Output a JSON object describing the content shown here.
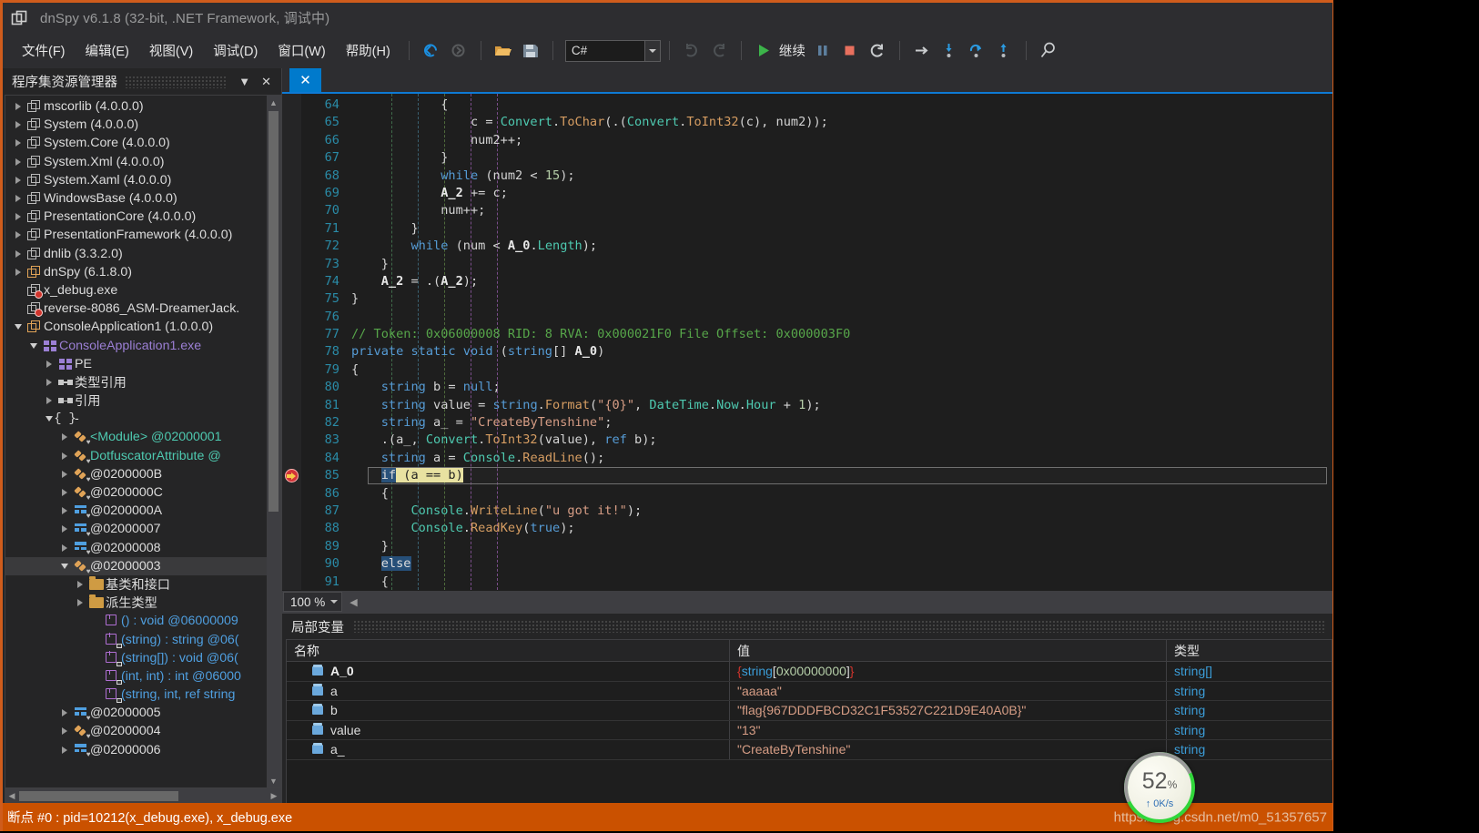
{
  "window": {
    "title": "dnSpy v6.1.8 (32-bit, .NET Framework, 调试中)",
    "icon": "assembly-icon"
  },
  "menu": {
    "items": [
      {
        "label": "文件(F)",
        "name": "menu-file"
      },
      {
        "label": "编辑(E)",
        "name": "menu-edit"
      },
      {
        "label": "视图(V)",
        "name": "menu-view"
      },
      {
        "label": "调试(D)",
        "name": "menu-debug"
      },
      {
        "label": "窗口(W)",
        "name": "menu-window"
      },
      {
        "label": "帮助(H)",
        "name": "menu-help"
      }
    ]
  },
  "toolbar": {
    "language_combo_value": "C#",
    "continue_label": "继续",
    "icons": [
      "back-icon",
      "forward-icon",
      "open-file-icon",
      "save-icon",
      "undo-icon",
      "redo-icon",
      "continue-play-icon",
      "pause-icon",
      "stop-icon",
      "restart-icon",
      "step-over-icon",
      "step-into-icon",
      "step-out-of-icon",
      "step-out-icon",
      "search-icon"
    ]
  },
  "sidebar": {
    "title": "程序集资源管理器",
    "dropdown_label": "▼",
    "close_label": "✕",
    "nodes": [
      {
        "label": "mscorlib (4.0.0.0)",
        "indent": 0,
        "twist": "closed",
        "icon": "assembly-icon",
        "name": "tree-node-mscorlib"
      },
      {
        "label": "System (4.0.0.0)",
        "indent": 0,
        "twist": "closed",
        "icon": "assembly-icon",
        "name": "tree-node-system"
      },
      {
        "label": "System.Core (4.0.0.0)",
        "indent": 0,
        "twist": "closed",
        "icon": "assembly-icon",
        "name": "tree-node-system-core"
      },
      {
        "label": "System.Xml (4.0.0.0)",
        "indent": 0,
        "twist": "closed",
        "icon": "assembly-icon",
        "name": "tree-node-system-xml"
      },
      {
        "label": "System.Xaml (4.0.0.0)",
        "indent": 0,
        "twist": "closed",
        "icon": "assembly-icon",
        "name": "tree-node-system-xaml"
      },
      {
        "label": "WindowsBase (4.0.0.0)",
        "indent": 0,
        "twist": "closed",
        "icon": "assembly-icon",
        "name": "tree-node-windowsbase"
      },
      {
        "label": "PresentationCore (4.0.0.0)",
        "indent": 0,
        "twist": "closed",
        "icon": "assembly-icon",
        "name": "tree-node-presentationcore"
      },
      {
        "label": "PresentationFramework (4.0.0.0)",
        "indent": 0,
        "twist": "closed",
        "icon": "assembly-icon",
        "name": "tree-node-presentationframework"
      },
      {
        "label": "dnlib (3.3.2.0)",
        "indent": 0,
        "twist": "closed",
        "icon": "assembly-icon",
        "name": "tree-node-dnlib"
      },
      {
        "label": "dnSpy (6.1.8.0)",
        "indent": 0,
        "twist": "closed",
        "icon": "assembly-icon-orange",
        "name": "tree-node-dnspy"
      },
      {
        "label": "x_debug.exe",
        "indent": 0,
        "twist": "none",
        "icon": "assembly-error-icon",
        "name": "tree-node-x-debug"
      },
      {
        "label": "reverse-8086_ASM-DreamerJack.",
        "indent": 0,
        "twist": "none",
        "icon": "assembly-error-icon",
        "name": "tree-node-reverse-8086"
      },
      {
        "label": "ConsoleApplication1 (1.0.0.0)",
        "indent": 0,
        "twist": "open",
        "icon": "assembly-icon-orange",
        "name": "tree-node-consoleapplication1"
      },
      {
        "label": "ConsoleApplication1.exe",
        "indent": 1,
        "twist": "open",
        "icon": "module-icon",
        "name": "tree-node-consoleapplication1-exe",
        "color": "#9b7fd4"
      },
      {
        "label": "PE",
        "indent": 2,
        "twist": "closed",
        "icon": "module-icon",
        "name": "tree-node-pe"
      },
      {
        "label": "类型引用",
        "indent": 2,
        "twist": "closed",
        "icon": "reference-icon",
        "name": "tree-node-type-references"
      },
      {
        "label": "引用",
        "indent": 2,
        "twist": "closed",
        "icon": "reference-icon",
        "name": "tree-node-references"
      },
      {
        "label": "-",
        "indent": 2,
        "twist": "open",
        "icon": "namespace-icon",
        "name": "tree-node-namespace"
      },
      {
        "label": "<Module> @02000001",
        "indent": 3,
        "twist": "closed",
        "icon": "class-icon",
        "name": "tree-node-module-class",
        "color": "#4ec9b0"
      },
      {
        "label": "DotfuscatorAttribute @",
        "indent": 3,
        "twist": "closed",
        "icon": "class-icon",
        "name": "tree-node-dotfuscatorattribute",
        "color": "#4ec9b0"
      },
      {
        "label": "@0200000B",
        "indent": 3,
        "twist": "closed",
        "icon": "class-icon",
        "name": "tree-node-0200000b"
      },
      {
        "label": "@0200000C",
        "indent": 3,
        "twist": "closed",
        "icon": "class-icon",
        "name": "tree-node-0200000c"
      },
      {
        "label": "@0200000A",
        "indent": 3,
        "twist": "closed",
        "icon": "interface-icon",
        "name": "tree-node-0200000a"
      },
      {
        "label": "@02000007",
        "indent": 3,
        "twist": "closed",
        "icon": "interface-icon",
        "name": "tree-node-02000007"
      },
      {
        "label": "@02000008",
        "indent": 3,
        "twist": "closed",
        "icon": "interface-icon",
        "name": "tree-node-02000008"
      },
      {
        "label": "@02000003",
        "indent": 3,
        "twist": "open",
        "icon": "class-icon",
        "name": "tree-node-02000003",
        "selected": true
      },
      {
        "label": "基类和接口",
        "indent": 4,
        "twist": "closed",
        "icon": "folder-icon",
        "name": "tree-node-base-types"
      },
      {
        "label": "派生类型",
        "indent": 4,
        "twist": "closed",
        "icon": "folder-icon",
        "name": "tree-node-derived-types"
      },
      {
        "label": "() : void @06000009",
        "indent": 5,
        "twist": "none",
        "icon": "method-icon",
        "name": "tree-node-method-ctor",
        "color": "#4f9fe0"
      },
      {
        "label": "(string) : string @06(",
        "indent": 5,
        "twist": "none",
        "icon": "method-lock-icon",
        "name": "tree-node-method-string",
        "color": "#4f9fe0"
      },
      {
        "label": "(string[]) : void @06(",
        "indent": 5,
        "twist": "none",
        "icon": "method-lock-icon",
        "name": "tree-node-method-stringarr",
        "color": "#4f9fe0"
      },
      {
        "label": "(int, int) : int @06000",
        "indent": 5,
        "twist": "none",
        "icon": "method-lock-icon",
        "name": "tree-node-method-intint",
        "color": "#4f9fe0"
      },
      {
        "label": "(string, int, ref string",
        "indent": 5,
        "twist": "none",
        "icon": "method-lock-icon",
        "name": "tree-node-method-stringintref",
        "color": "#4f9fe0"
      },
      {
        "label": "@02000005",
        "indent": 3,
        "twist": "closed",
        "icon": "interface-icon",
        "name": "tree-node-02000005"
      },
      {
        "label": "@02000004",
        "indent": 3,
        "twist": "closed",
        "icon": "class-icon",
        "name": "tree-node-02000004"
      },
      {
        "label": "@02000006",
        "indent": 3,
        "twist": "closed",
        "icon": "interface-icon",
        "name": "tree-node-02000006"
      }
    ]
  },
  "editor": {
    "tab_close_label": "✕",
    "zoom_level": "100 %",
    "breakpoint_line": 85,
    "lines": [
      {
        "n": 64,
        "tokens": [
          {
            "t": "            {",
            "c": "pl"
          }
        ]
      },
      {
        "n": 65,
        "tokens": [
          {
            "t": "                c = ",
            "c": "pl"
          },
          {
            "t": "Convert",
            "c": "ty"
          },
          {
            "t": ".",
            "c": "pl"
          },
          {
            "t": "ToChar",
            "c": "mth"
          },
          {
            "t": "(.(",
            "c": "pl"
          },
          {
            "t": "Convert",
            "c": "ty"
          },
          {
            "t": ".",
            "c": "pl"
          },
          {
            "t": "ToInt32",
            "c": "mth"
          },
          {
            "t": "(c), num2));",
            "c": "pl"
          }
        ]
      },
      {
        "n": 66,
        "tokens": [
          {
            "t": "                num2++;",
            "c": "pl"
          }
        ]
      },
      {
        "n": 67,
        "tokens": [
          {
            "t": "            }",
            "c": "pl"
          }
        ]
      },
      {
        "n": 68,
        "tokens": [
          {
            "t": "            ",
            "c": "pl"
          },
          {
            "t": "while",
            "c": "k"
          },
          {
            "t": " (num2 < ",
            "c": "pl"
          },
          {
            "t": "15",
            "c": "num"
          },
          {
            "t": ");",
            "c": "pl"
          }
        ]
      },
      {
        "n": 69,
        "tokens": [
          {
            "t": "            ",
            "c": "pl"
          },
          {
            "t": "A_2",
            "c": "bold"
          },
          {
            "t": " += c;",
            "c": "pl"
          }
        ]
      },
      {
        "n": 70,
        "tokens": [
          {
            "t": "            num++;",
            "c": "pl"
          }
        ]
      },
      {
        "n": 71,
        "tokens": [
          {
            "t": "        }",
            "c": "pl"
          }
        ]
      },
      {
        "n": 72,
        "tokens": [
          {
            "t": "        ",
            "c": "pl"
          },
          {
            "t": "while",
            "c": "k"
          },
          {
            "t": " (num < ",
            "c": "pl"
          },
          {
            "t": "A_0",
            "c": "bold"
          },
          {
            "t": ".",
            "c": "pl"
          },
          {
            "t": "Length",
            "c": "ty"
          },
          {
            "t": ");",
            "c": "pl"
          }
        ]
      },
      {
        "n": 73,
        "tokens": [
          {
            "t": "    }",
            "c": "pl"
          }
        ]
      },
      {
        "n": 74,
        "tokens": [
          {
            "t": "    ",
            "c": "pl"
          },
          {
            "t": "A_2",
            "c": "bold"
          },
          {
            "t": " = .(",
            "c": "pl"
          },
          {
            "t": "A_2",
            "c": "bold"
          },
          {
            "t": ");",
            "c": "pl"
          }
        ]
      },
      {
        "n": 75,
        "tokens": [
          {
            "t": "}",
            "c": "pl"
          }
        ]
      },
      {
        "n": 76,
        "tokens": [
          {
            "t": "",
            "c": "pl"
          }
        ]
      },
      {
        "n": 77,
        "tokens": [
          {
            "t": "// Token: 0x06000008 RID: 8 RVA: 0x000021F0 File Offset: 0x000003F0",
            "c": "cm"
          }
        ]
      },
      {
        "n": 78,
        "tokens": [
          {
            "t": "private static void",
            "c": "k"
          },
          {
            "t": " (",
            "c": "pl"
          },
          {
            "t": "string",
            "c": "k"
          },
          {
            "t": "[] ",
            "c": "pl"
          },
          {
            "t": "A_0",
            "c": "bold"
          },
          {
            "t": ")",
            "c": "pl"
          }
        ]
      },
      {
        "n": 79,
        "tokens": [
          {
            "t": "{",
            "c": "pl"
          }
        ]
      },
      {
        "n": 80,
        "tokens": [
          {
            "t": "    ",
            "c": "pl"
          },
          {
            "t": "string",
            "c": "k"
          },
          {
            "t": " b = ",
            "c": "pl"
          },
          {
            "t": "null",
            "c": "k"
          },
          {
            "t": ";",
            "c": "pl"
          }
        ]
      },
      {
        "n": 81,
        "tokens": [
          {
            "t": "    ",
            "c": "pl"
          },
          {
            "t": "string",
            "c": "k"
          },
          {
            "t": " value = ",
            "c": "pl"
          },
          {
            "t": "string",
            "c": "k"
          },
          {
            "t": ".",
            "c": "pl"
          },
          {
            "t": "Format",
            "c": "mth"
          },
          {
            "t": "(",
            "c": "pl"
          },
          {
            "t": "\"{0}\"",
            "c": "str"
          },
          {
            "t": ", ",
            "c": "pl"
          },
          {
            "t": "DateTime",
            "c": "ty"
          },
          {
            "t": ".",
            "c": "pl"
          },
          {
            "t": "Now",
            "c": "ty"
          },
          {
            "t": ".",
            "c": "pl"
          },
          {
            "t": "Hour",
            "c": "ty"
          },
          {
            "t": " + ",
            "c": "pl"
          },
          {
            "t": "1",
            "c": "num"
          },
          {
            "t": ");",
            "c": "pl"
          }
        ]
      },
      {
        "n": 82,
        "tokens": [
          {
            "t": "    ",
            "c": "pl"
          },
          {
            "t": "string",
            "c": "k"
          },
          {
            "t": " a_ = ",
            "c": "pl"
          },
          {
            "t": "\"CreateByTenshine\"",
            "c": "str"
          },
          {
            "t": ";",
            "c": "pl"
          }
        ]
      },
      {
        "n": 83,
        "tokens": [
          {
            "t": "    .(a_, ",
            "c": "pl"
          },
          {
            "t": "Convert",
            "c": "ty"
          },
          {
            "t": ".",
            "c": "pl"
          },
          {
            "t": "ToInt32",
            "c": "mth"
          },
          {
            "t": "(value), ",
            "c": "pl"
          },
          {
            "t": "ref",
            "c": "k"
          },
          {
            "t": " b);",
            "c": "pl"
          }
        ]
      },
      {
        "n": 84,
        "tokens": [
          {
            "t": "    ",
            "c": "pl"
          },
          {
            "t": "string",
            "c": "k"
          },
          {
            "t": " a = ",
            "c": "pl"
          },
          {
            "t": "Console",
            "c": "ty"
          },
          {
            "t": ".",
            "c": "pl"
          },
          {
            "t": "ReadLine",
            "c": "mth"
          },
          {
            "t": "();",
            "c": "pl"
          }
        ]
      },
      {
        "n": 85,
        "highlight": true,
        "tokens": [
          {
            "t": "    ",
            "c": "pl"
          },
          {
            "t": "if",
            "c": "sel-blue"
          },
          {
            "t": " (a == b)",
            "c": "sel-yellow"
          }
        ]
      },
      {
        "n": 86,
        "tokens": [
          {
            "t": "    {",
            "c": "pl"
          }
        ]
      },
      {
        "n": 87,
        "tokens": [
          {
            "t": "        ",
            "c": "pl"
          },
          {
            "t": "Console",
            "c": "ty"
          },
          {
            "t": ".",
            "c": "pl"
          },
          {
            "t": "WriteLine",
            "c": "mth"
          },
          {
            "t": "(",
            "c": "pl"
          },
          {
            "t": "\"u got it!\"",
            "c": "str"
          },
          {
            "t": ");",
            "c": "pl"
          }
        ]
      },
      {
        "n": 88,
        "tokens": [
          {
            "t": "        ",
            "c": "pl"
          },
          {
            "t": "Console",
            "c": "ty"
          },
          {
            "t": ".",
            "c": "pl"
          },
          {
            "t": "ReadKey",
            "c": "mth"
          },
          {
            "t": "(",
            "c": "pl"
          },
          {
            "t": "true",
            "c": "k"
          },
          {
            "t": ");",
            "c": "pl"
          }
        ]
      },
      {
        "n": 89,
        "tokens": [
          {
            "t": "    }",
            "c": "pl"
          }
        ]
      },
      {
        "n": 90,
        "tokens": [
          {
            "t": "    ",
            "c": "pl"
          },
          {
            "t": "else",
            "c": "sel-blue"
          }
        ]
      },
      {
        "n": 91,
        "tokens": [
          {
            "t": "    {",
            "c": "pl"
          }
        ]
      }
    ]
  },
  "locals": {
    "title": "局部变量",
    "columns": [
      "名称",
      "值",
      "类型"
    ],
    "rows": [
      {
        "name": "A_0",
        "bold": true,
        "value": "{string[0x00000000]}",
        "value_kind": "object",
        "type": "string[]"
      },
      {
        "name": "a",
        "bold": false,
        "value": "\"aaaaa\"",
        "value_kind": "string",
        "type": "string"
      },
      {
        "name": "b",
        "bold": false,
        "value": "\"flag{967DDDFBCD32C1F53527C221D9E40A0B}\"",
        "value_kind": "string",
        "type": "string"
      },
      {
        "name": "value",
        "bold": false,
        "value": "\"13\"",
        "value_kind": "string",
        "type": "string"
      },
      {
        "name": "a_",
        "bold": false,
        "value": "\"CreateByTenshine\"",
        "value_kind": "string",
        "type": "string"
      }
    ]
  },
  "statusbar": {
    "text": "断点 #0 : pid=10212(x_debug.exe), x_debug.exe",
    "watermark": "https://blog.csdn.net/m0_51357657"
  },
  "network_widget": {
    "percent": "52",
    "percent_unit": "%",
    "speed": "0K/s",
    "arrow": "↑"
  },
  "colors": {
    "accent_orange": "#ca5100",
    "accent_blue": "#007acc",
    "panel_bg": "#252526",
    "editor_bg": "#1e1e1e",
    "widget_green": "#30d63a"
  }
}
